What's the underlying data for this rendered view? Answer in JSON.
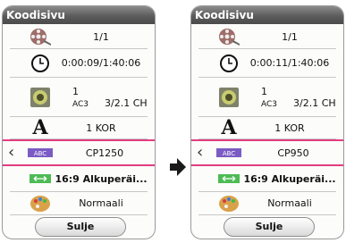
{
  "dialog_left": {
    "title": "Koodisivu",
    "rows": [
      {
        "icon": "film-reel-icon",
        "value": "1/1"
      },
      {
        "icon": "clock-icon",
        "value": "0:00:09/1:40:06"
      },
      {
        "icon": "speaker-icon",
        "value": "1",
        "codec": "AC3",
        "channels": "3/2.1 CH"
      },
      {
        "icon": "font-a-icon",
        "value": "1 KOR"
      },
      {
        "icon": "subtitle-abc-icon",
        "value": "CP1250"
      },
      {
        "icon": "aspect-ratio-icon",
        "value": "16:9 Alkuperäi..."
      },
      {
        "icon": "palette-icon",
        "value": "Normaali"
      }
    ],
    "close_label": "Sulje"
  },
  "dialog_right": {
    "title": "Koodisivu",
    "rows": [
      {
        "icon": "film-reel-icon",
        "value": "1/1"
      },
      {
        "icon": "clock-icon",
        "value": "0:00:11/1:40:06"
      },
      {
        "icon": "speaker-icon",
        "value": "1",
        "codec": "AC3",
        "channels": "3/2.1 CH"
      },
      {
        "icon": "font-a-icon",
        "value": "1 KOR"
      },
      {
        "icon": "subtitle-abc-icon",
        "value": "CP950"
      },
      {
        "icon": "aspect-ratio-icon",
        "value": "16:9 Alkuperäi..."
      },
      {
        "icon": "palette-icon",
        "value": "Normaali"
      }
    ],
    "close_label": "Sulje"
  },
  "colors": {
    "title_bar": "#5c5c5c",
    "highlight": "#e23d80",
    "arrow": "#1a1a1a"
  }
}
